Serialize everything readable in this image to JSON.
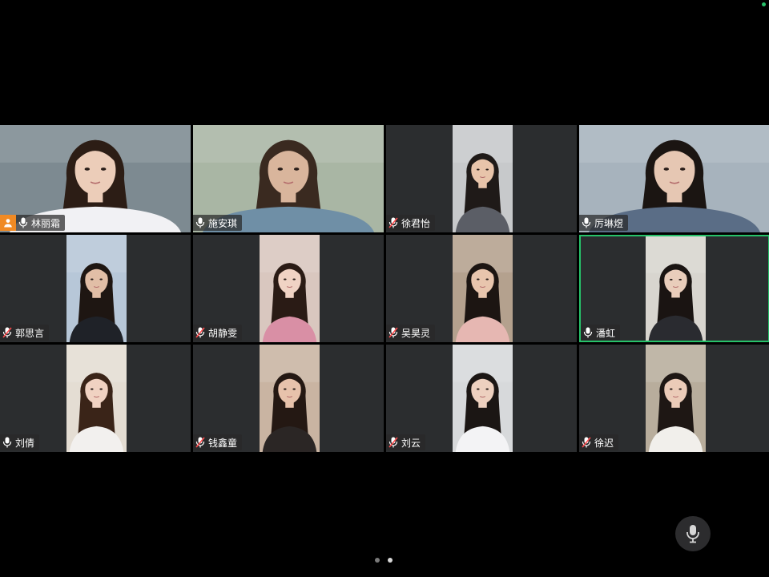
{
  "colors": {
    "active_border": "#27c26a",
    "status_dot": "#27c26a",
    "host_badge": "#f08a24",
    "mic_on": "#ffffff",
    "mic_muted_slash": "#ff4d4f",
    "dot_active": "#d8d8d8",
    "dot_inactive": "#7a7a7a"
  },
  "participants": [
    {
      "name": "林丽霜",
      "host": true,
      "muted": false,
      "active": false,
      "video": "full",
      "skin": "#eccdb9",
      "hair": "#2c1d15",
      "bg": "#7d8a91",
      "shirt": "#f1f1f4"
    },
    {
      "name": "施安琪",
      "host": false,
      "muted": false,
      "active": false,
      "video": "full",
      "skin": "#d9b59c",
      "hair": "#3a2a20",
      "bg": "#a9b6a4",
      "shirt": "#6f8fa6"
    },
    {
      "name": "徐君怡",
      "host": false,
      "muted": true,
      "active": false,
      "video": "narrow",
      "skin": "#e8c4aa",
      "hair": "#1f1a18",
      "bg": "#c7c9cb",
      "shirt": "#5b5e66"
    },
    {
      "name": "厉琳煜",
      "host": false,
      "muted": false,
      "active": false,
      "video": "full",
      "skin": "#e6c7b3",
      "hair": "#1b1512",
      "bg": "#a7b3bd",
      "shirt": "#5a6d86"
    },
    {
      "name": "郭思言",
      "host": false,
      "muted": true,
      "active": false,
      "video": "narrow",
      "skin": "#e1bea6",
      "hair": "#1e1612",
      "bg": "#b7c7d8",
      "shirt": "#1f2228"
    },
    {
      "name": "胡静雯",
      "host": false,
      "muted": true,
      "active": false,
      "video": "narrow",
      "skin": "#f0d3c4",
      "hair": "#2a1b15",
      "bg": "#d9c7bf",
      "shirt": "#d98fa5"
    },
    {
      "name": "吴昊灵",
      "host": false,
      "muted": true,
      "active": false,
      "video": "narrow",
      "skin": "#e8c5ad",
      "hair": "#1c1512",
      "bg": "#b4a18e",
      "shirt": "#e6b7b2"
    },
    {
      "name": "潘虹",
      "host": false,
      "muted": false,
      "active": true,
      "video": "narrow",
      "skin": "#e9cdbb",
      "hair": "#1a1412",
      "bg": "#d8d5cf",
      "shirt": "#2a2b30"
    },
    {
      "name": "刘倩",
      "host": false,
      "muted": false,
      "active": false,
      "video": "narrow",
      "skin": "#f0d2c2",
      "hair": "#3a2418",
      "bg": "#e4ddd3",
      "shirt": "#f2f0ee"
    },
    {
      "name": "钱鑫童",
      "host": false,
      "muted": true,
      "active": false,
      "video": "narrow",
      "skin": "#e7c2ab",
      "hair": "#241813",
      "bg": "#c9b4a2",
      "shirt": "#2b2625"
    },
    {
      "name": "刘云",
      "host": false,
      "muted": true,
      "active": false,
      "video": "narrow",
      "skin": "#edd0bf",
      "hair": "#1b1614",
      "bg": "#d7d9db",
      "shirt": "#f3f3f5"
    },
    {
      "name": "徐迟",
      "host": false,
      "muted": true,
      "active": false,
      "video": "narrow",
      "skin": "#ebcbb8",
      "hair": "#1e1714",
      "bg": "#b8ad9c",
      "shirt": "#f1efeb"
    }
  ],
  "pager": {
    "count": 2,
    "current": 1
  }
}
